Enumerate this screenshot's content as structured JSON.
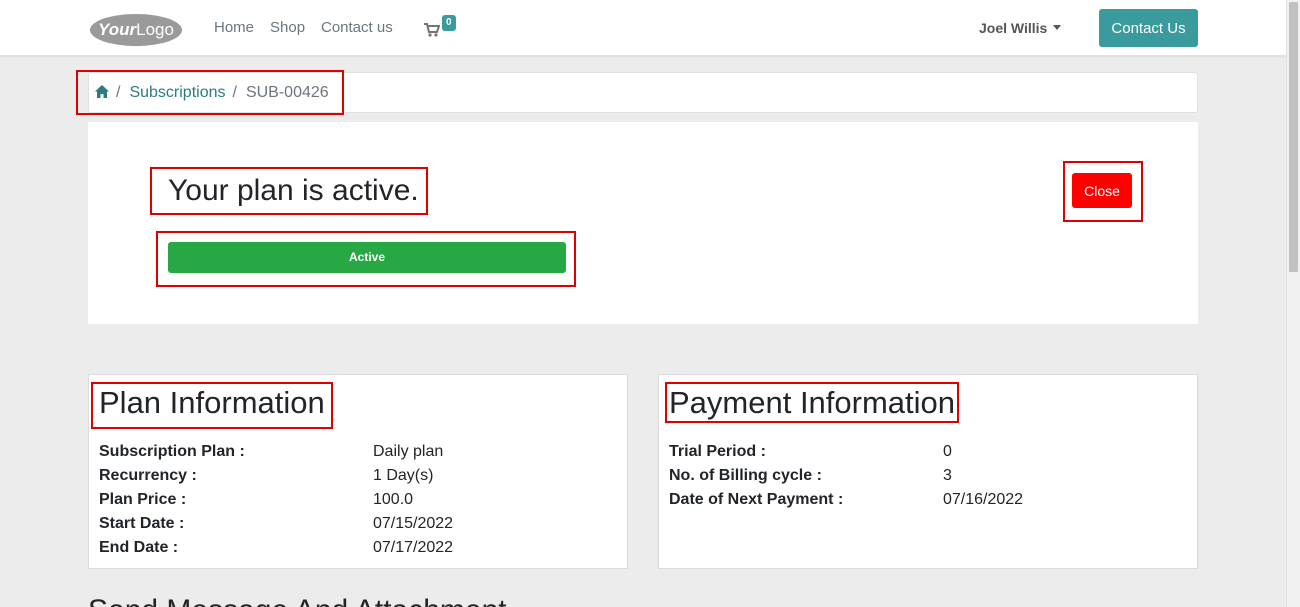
{
  "navbar": {
    "logo_text": "YourLogo",
    "links": [
      "Home",
      "Shop",
      "Contact us"
    ],
    "cart_count": "0",
    "cart_icon": "shopping-cart-icon",
    "user_name": "Joel Willis",
    "contact_button": "Contact Us"
  },
  "breadcrumb": {
    "home_icon": "home-icon",
    "subscriptions": "Subscriptions",
    "current": "SUB-00426",
    "separator": "/"
  },
  "status": {
    "title": "Your plan is active.",
    "badge": "Active",
    "close_button": "Close"
  },
  "plan_info": {
    "title": "Plan Information",
    "rows": [
      {
        "label": "Subscription Plan :",
        "value": "Daily plan"
      },
      {
        "label": "Recurrency :",
        "value": "1 Day(s)"
      },
      {
        "label": "Plan Price :",
        "value": "100.0"
      },
      {
        "label": "Start Date :",
        "value": "07/15/2022"
      },
      {
        "label": "End Date :",
        "value": "07/17/2022"
      }
    ]
  },
  "payment_info": {
    "title": "Payment Information",
    "rows": [
      {
        "label": "Trial Period :",
        "value": "0"
      },
      {
        "label": "No. of Billing cycle :",
        "value": "3"
      },
      {
        "label": "Date of Next Payment :",
        "value": "07/16/2022"
      }
    ]
  },
  "next_section_heading": "Send Message And Attachment",
  "colors": {
    "accent": "#3a9b9f",
    "active_green": "#28a745",
    "close_red": "#ff0000",
    "annotation_red": "#e00000"
  }
}
